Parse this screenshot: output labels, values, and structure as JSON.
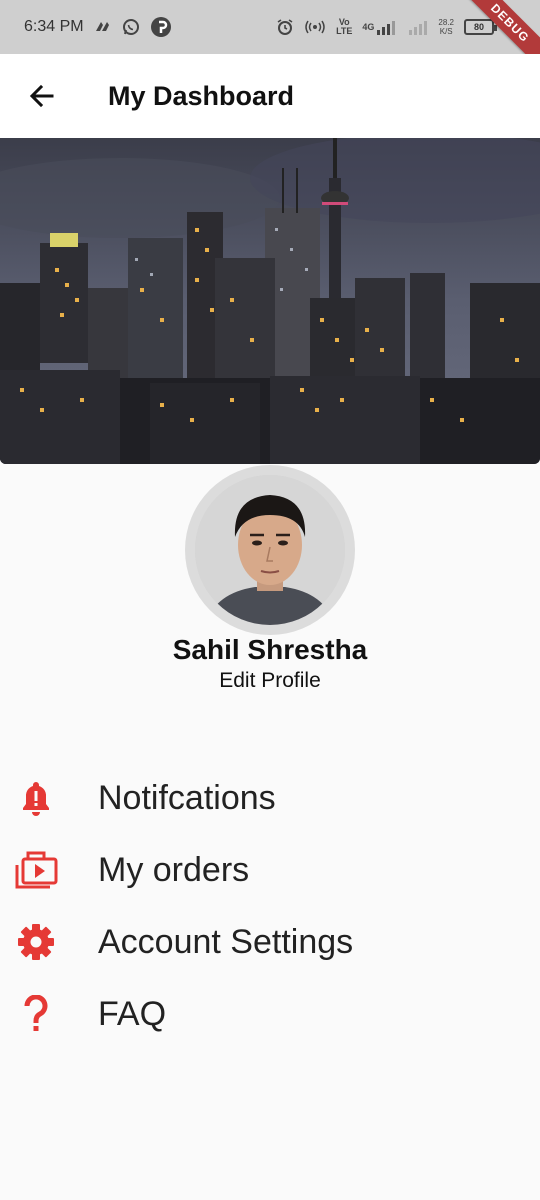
{
  "status_bar": {
    "time": "6:34 PM",
    "volte": "Vo\nLTE",
    "network": "4G",
    "speed_value": "28.2",
    "speed_unit": "K/S",
    "battery": "80",
    "debug_label": "DEBUG",
    "icons": [
      "edge-icon",
      "whatsapp-icon",
      "pinterest-icon",
      "alarm-icon",
      "hotspot-icon",
      "signal-icon",
      "battery-icon"
    ]
  },
  "app_bar": {
    "title": "My Dashboard",
    "back_icon": "arrow-left-icon"
  },
  "profile": {
    "name": "Sahil Shrestha",
    "edit_label": "Edit Profile"
  },
  "menu": {
    "accent_color": "#e53935",
    "items": [
      {
        "label": "Notifcations",
        "icon": "bell-alert-icon"
      },
      {
        "label": "My orders",
        "icon": "orders-icon"
      },
      {
        "label": "Account Settings",
        "icon": "gear-icon"
      },
      {
        "label": "FAQ",
        "icon": "question-icon"
      }
    ]
  }
}
